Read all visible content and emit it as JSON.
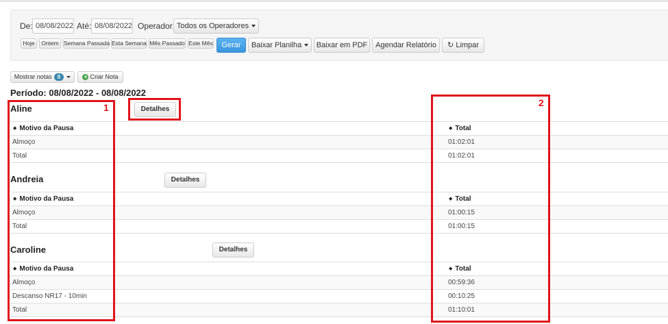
{
  "filters": {
    "de_label": "De:",
    "de_value": "08/08/2022",
    "ate_label": "Até:",
    "ate_value": "08/08/2022",
    "operador_label": "Operador:",
    "operador_value": "Todos os Operadores",
    "quick_ranges": [
      "Hoje",
      "Ontem",
      "Semana Passada",
      "Esta Semana",
      "Mês Passado",
      "Este Mês"
    ],
    "gerar": "Gerar",
    "baixar_planilha": "Baixar Planilha",
    "baixar_pdf": "Baixar em PDF",
    "agendar": "Agendar Relatório",
    "limpar": "Limpar"
  },
  "notes": {
    "mostrar_notas": "Mostrar notas",
    "count": "0",
    "criar_nota": "Criar Nota"
  },
  "periodo": "Período: 08/08/2022 - 08/08/2022",
  "columns": {
    "motivo": "Motivo da Pausa",
    "total": "Total"
  },
  "operators": [
    {
      "name": "Aline",
      "details_label": "Detalhes",
      "rows": [
        {
          "motivo": "Almoço",
          "total": "01:02:01"
        },
        {
          "motivo": "Total",
          "total": "01:02:01"
        }
      ]
    },
    {
      "name": "Andreia",
      "details_label": "Detalhes",
      "rows": [
        {
          "motivo": "Almoço",
          "total": "01:00:15"
        },
        {
          "motivo": "Total",
          "total": "01:00:15"
        }
      ]
    },
    {
      "name": "Caroline",
      "details_label": "Detalhes",
      "rows": [
        {
          "motivo": "Almoço",
          "total": "00:59:36"
        },
        {
          "motivo": "Descanso NR17 - 10min",
          "total": "00:10:25"
        },
        {
          "motivo": "Total",
          "total": "01:10:01"
        }
      ]
    }
  ],
  "annotations": {
    "box1": "1",
    "box2": "2",
    "color": "#e0121b"
  }
}
